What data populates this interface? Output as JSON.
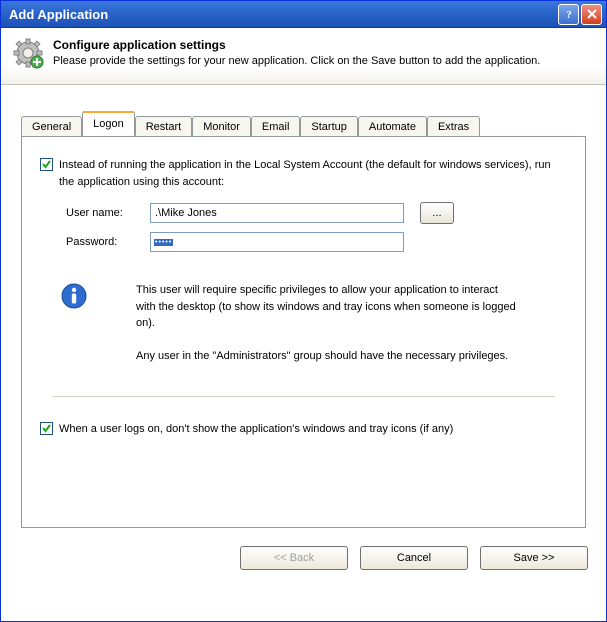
{
  "window": {
    "title": "Add Application"
  },
  "header": {
    "title": "Configure application settings",
    "subtitle": "Please provide the settings for your new application. Click on the Save button to add the application."
  },
  "tabs": {
    "items": [
      "General",
      "Logon",
      "Restart",
      "Monitor",
      "Email",
      "Startup",
      "Automate",
      "Extras"
    ],
    "active_index": 1
  },
  "logon": {
    "run_as_user_checkbox_label": "Instead of running the application in the Local System Account (the default for windows services), run the application using this account:",
    "username_label": "User name:",
    "username_value": ".\\Mike Jones",
    "password_label": "Password:",
    "password_value": "•••••",
    "browse_label": "...",
    "info_p1": "This user will require specific privileges to allow your application to interact with the desktop (to show its windows and tray icons when someone is logged on).",
    "info_p2": "Any user in the \"Administrators\" group should have the necessary privileges.",
    "hide_windows_checkbox_label": "When a user logs on, don't show the application's windows and tray icons (if any)"
  },
  "buttons": {
    "back": "<< Back",
    "cancel": "Cancel",
    "save": "Save >>"
  },
  "colors": {
    "titlebar_blue": "#2862c8",
    "tab_highlight": "#f8a830",
    "checkbox_check": "#21a121",
    "selection_blue": "#316ac5"
  }
}
